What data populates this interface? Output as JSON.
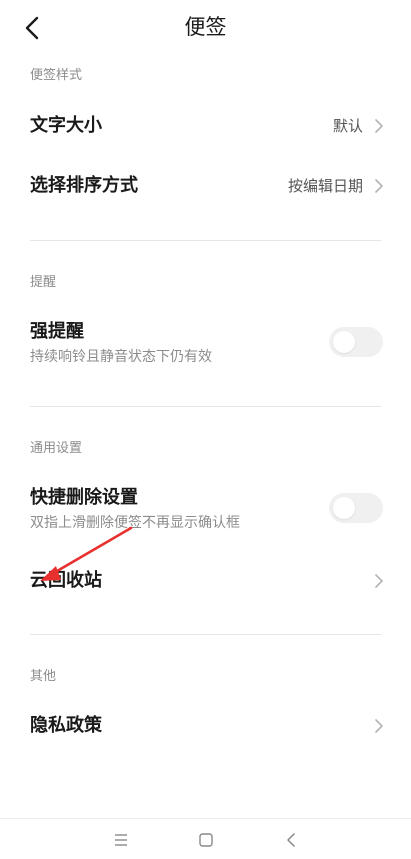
{
  "header": {
    "title": "便签"
  },
  "sections": {
    "style": {
      "label": "便签样式"
    },
    "remind": {
      "label": "提醒"
    },
    "general": {
      "label": "通用设置"
    },
    "other": {
      "label": "其他"
    }
  },
  "rows": {
    "font_size": {
      "title": "文字大小",
      "value": "默认"
    },
    "sort": {
      "title": "选择排序方式",
      "value": "按编辑日期"
    },
    "strong_remind": {
      "title": "强提醒",
      "sub": "持续响铃且静音状态下仍有效",
      "toggle_on": false
    },
    "quick_delete": {
      "title": "快捷删除设置",
      "sub": "双指上滑删除便签不再显示确认框",
      "toggle_on": false
    },
    "cloud_trash": {
      "title": "云回收站"
    },
    "privacy": {
      "title": "隐私政策"
    }
  },
  "colors": {
    "annotation_arrow": "#e8302f",
    "toggle_off": "#f0f0f0"
  },
  "icons": [
    "back-arrow-icon",
    "chevron-right-icon",
    "menu-icon",
    "home-icon",
    "back-icon"
  ]
}
